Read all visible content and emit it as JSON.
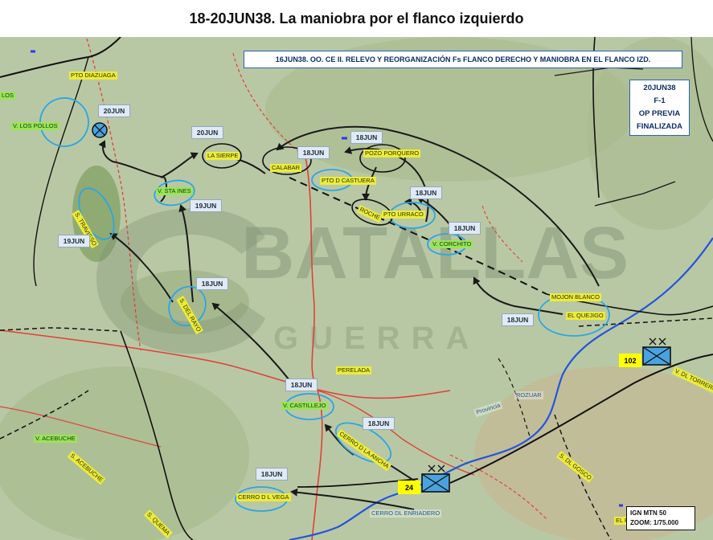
{
  "title": "18-20JUN38. La maniobra por el flanco izquierdo",
  "header_note": "16JUN38. OO.  CE II. RELEVO Y REORGANIZACIÓN Fs FLANCO DERECHO Y MANIOBRA EN EL FLANCO IZD.",
  "status_box": {
    "line1": "20JUN38",
    "line2": "F-1",
    "line3": "OP PREVIA",
    "line4": "FINALIZADA"
  },
  "source_box": {
    "line1": "IGN MTN 50",
    "line2": "ZOOM: 1/75.000"
  },
  "watermark": {
    "line1": "BATALLAS",
    "line2": "GUERRA"
  },
  "place_labels": {
    "pto_diazuaga": "PTO DIAZUAGA",
    "v_los_pollos": "V. LOS POLLOS",
    "la_sierpe": "LA SIERPE",
    "calabar": "CALABAR",
    "pto_d_castuera": "PTO D CASTUERA",
    "pozo_porquero": "POZO PORQUERO",
    "v_sta_ines": "V. STA INES",
    "s_travieso": "S. TRAVIESO",
    "roche": "ROCHE",
    "pto_urraco": "PTO URRACO",
    "v_corchito": "V. CORCHITO",
    "s_del_rayo": "S. DEL RAYO",
    "mojon_blanco": "MOJON BLANCO",
    "el_quejigo": "EL QUEJIGO",
    "perelada": "PERELADA",
    "v_castillejo": "V. CASTILLEJO",
    "rozuar": "ROZUAR",
    "cerro_d_la_ancha": "CERRO D LA ANCHA",
    "v_acebuche": "V. ACEBUCHE",
    "s_acebuche": "S. ACEBUCHE",
    "cerro_dl_vega": "CERRO D L VEGA",
    "cerro_dl_enriadero": "CERRO DL ENRIADERO",
    "s_dl_gosco": "S. DL GOSCO",
    "s_quema": "S. QUEMA",
    "v_dl_torrero": "V. DL TORRERO",
    "el_ra": "EL RA",
    "los": "LOS",
    "provincia": "Provincia"
  },
  "date_tags": {
    "d20jun_a": "20JUN",
    "d20jun_b": "20JUN",
    "d19jun_a": "19JUN",
    "d19jun_b": "19JUN",
    "d18jun_calabar": "18JUN",
    "d18jun_pozo": "18JUN",
    "d18jun_urraco": "18JUN",
    "d18jun_corchito": "18JUN",
    "d18jun_rayo": "18JUN",
    "d18jun_quejigo": "18JUN",
    "d18jun_castillejo": "18JUN",
    "d18jun_ancha": "18JUN",
    "d18jun_vega": "18JUN"
  },
  "units": [
    {
      "number": "102"
    },
    {
      "number": "24"
    }
  ],
  "colors": {
    "route_red": "#e0403a",
    "river_blue": "#2255dd",
    "ellipse_blue": "#2aa6e6",
    "arrow": "#1a1a1a",
    "unit_fill": "#4aa3e0"
  }
}
